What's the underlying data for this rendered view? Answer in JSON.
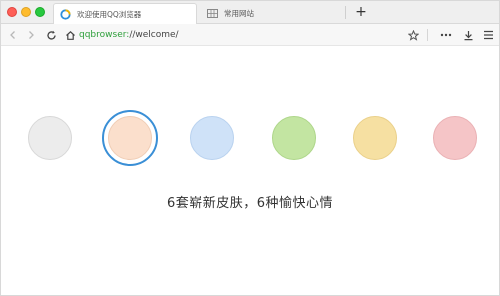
{
  "tabs": [
    {
      "label": "欢迎使用QQ浏览器",
      "icon": "qqbrowser-logo-icon",
      "active": true
    },
    {
      "label": "常用网站",
      "icon": "grid-page-icon",
      "active": false
    }
  ],
  "new_tab_label": "+",
  "address": {
    "scheme": "qqbrowser:",
    "path": "//welcome/"
  },
  "skins": {
    "caption": "6套崭新皮肤，6种愉快心情",
    "swatches": [
      {
        "name": "gray",
        "color": "#ececec",
        "border": "#d8d8d8",
        "selected": false
      },
      {
        "name": "peach",
        "color": "#fbdfcc",
        "border": "#f0cdb5",
        "selected": true
      },
      {
        "name": "blue",
        "color": "#cfe2f8",
        "border": "#b9d2ef",
        "selected": false
      },
      {
        "name": "green",
        "color": "#c3e5a2",
        "border": "#aed68a",
        "selected": false
      },
      {
        "name": "yellow",
        "color": "#f6e0a2",
        "border": "#ead08a",
        "selected": false
      },
      {
        "name": "pink",
        "color": "#f5c5c7",
        "border": "#eab1b4",
        "selected": false
      }
    ]
  }
}
